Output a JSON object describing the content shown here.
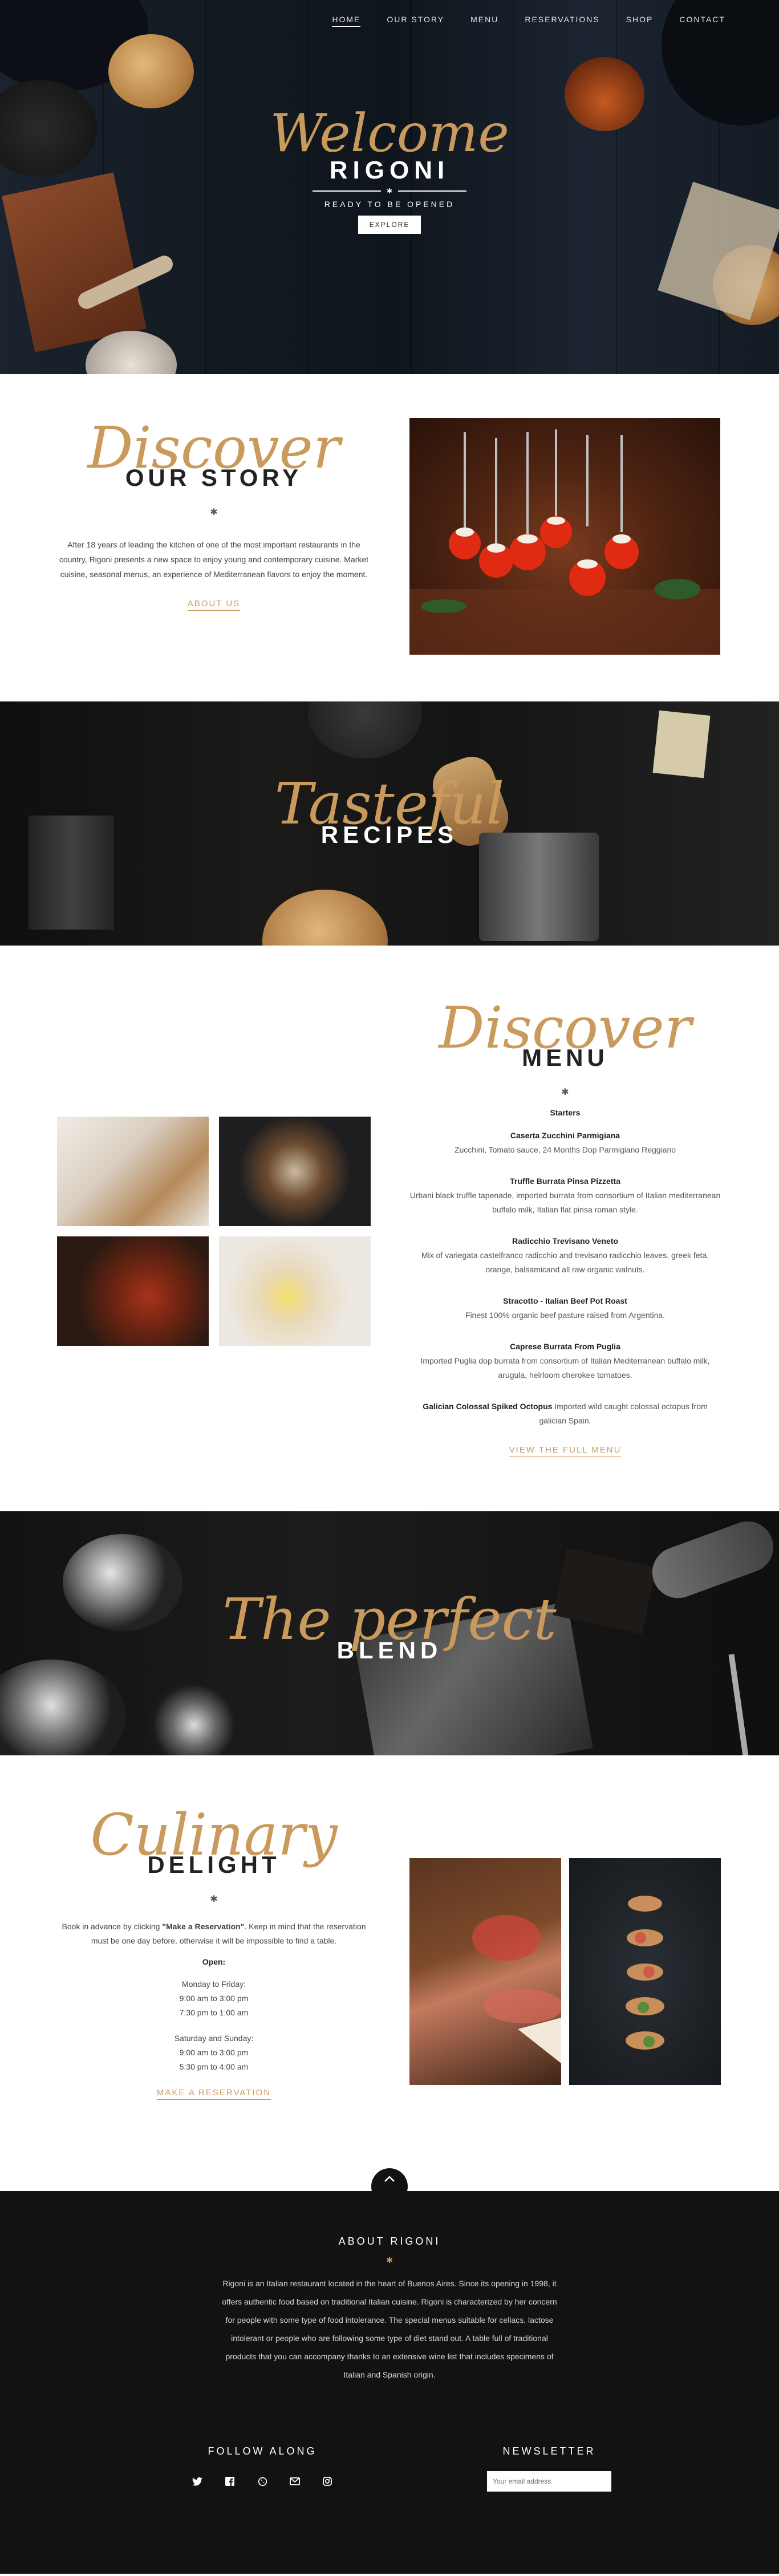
{
  "nav": {
    "items": [
      {
        "label": "HOME",
        "active": true
      },
      {
        "label": "OUR STORY"
      },
      {
        "label": "MENU"
      },
      {
        "label": "RESERVATIONS"
      },
      {
        "label": "SHOP"
      },
      {
        "label": "CONTACT"
      }
    ]
  },
  "hero": {
    "script": "Welcome",
    "title": "RIGONI",
    "subtitle": "READY TO BE OPENED",
    "button": "EXPLORE"
  },
  "story": {
    "script": "Discover",
    "title": "OUR STORY",
    "text": "After 18 years of leading the kitchen of one of the most important restaurants in the country, Rigoni presents a new space to enjoy young and contemporary cuisine. Market cuisine, seasonal menus, an experience of Mediterranean flavors to enjoy the moment.",
    "link": "ABOUT US"
  },
  "recipes": {
    "script": "Tasteful",
    "title": "RECIPES"
  },
  "menu": {
    "script": "Discover",
    "title": "MENU",
    "section": "Starters",
    "items": [
      {
        "name": "Caserta Zucchini Parmigiana",
        "desc": "Zucchini, Tomato sauce, 24 Months Dop Parmigiano Reggiano"
      },
      {
        "name": "Truffle Burrata Pinsa Pizzetta",
        "desc": "Urbani black truffle tapenade, imported burrata from consortium of Italian mediterranean buffalo milk, Italian flat pinsa roman style."
      },
      {
        "name": "Radicchio Trevisano Veneto",
        "desc": "Mix of variegata castelfranco radicchio and trevisano radicchio leaves, greek feta, orange, balsamicand all raw organic walnuts."
      },
      {
        "name": "Stracotto - Italian Beef Pot Roast",
        "desc": "Finest 100% organic beef pasture raised from Argentina."
      },
      {
        "name": "Caprese Burrata From Puglia",
        "desc": "Imported Puglia dop burrata from consortium of Italian Mediterranean buffalo milk, arugula, heirloom cherokee tomatoes."
      },
      {
        "name": "Galician Colossal Spiked Octopus",
        "desc": "Imported wild caught colossal octopus from galician Spain.",
        "inline": true
      }
    ],
    "link": "VIEW THE FULL MENU"
  },
  "blend": {
    "script": "The perfect",
    "title": "BLEND"
  },
  "culinary": {
    "script": "Culinary",
    "title": "DELIGHT",
    "text_before": "Book in advance by clicking ",
    "text_bold": "\"Make a Reservation\"",
    "text_after": ". Keep in mind that the reservation must be one day before, otherwise it will be impossible to find a table.",
    "open_label": "Open:",
    "weekdays": [
      "Monday to Friday:",
      "9:00 am to 3:00 pm",
      "7:30 pm to 1:00 am"
    ],
    "weekend": [
      "Saturday and Sunday:",
      "9:00 am to 3:00 pm",
      "5:30 pm to 4:00 am"
    ],
    "link": "MAKE A RESERVATION"
  },
  "footer": {
    "about_title": "ABOUT RIGONI",
    "about_text": "Rigoni is an Italian restaurant located in the heart of Buenos Aires. Since its opening in 1998, it offers authentic food based on traditional Italian cuisine. Rigoni is characterized by her concern for people with some type of food intolerance. The special menus suitable for celiacs, lactose intolerant or people who are following some type of diet stand out. A table full of traditional products that you can accompany thanks to an extensive wine list that includes specimens of Italian and Spanish origin.",
    "follow_title": "FOLLOW ALONG",
    "social": [
      "twitter-icon",
      "facebook-icon",
      "whatsapp-icon",
      "email-icon",
      "instagram-icon"
    ],
    "newsletter_title": "NEWSLETTER",
    "newsletter_placeholder": "Your email address"
  },
  "colors": {
    "accent": "#c99a5b",
    "dark": "#121212"
  }
}
